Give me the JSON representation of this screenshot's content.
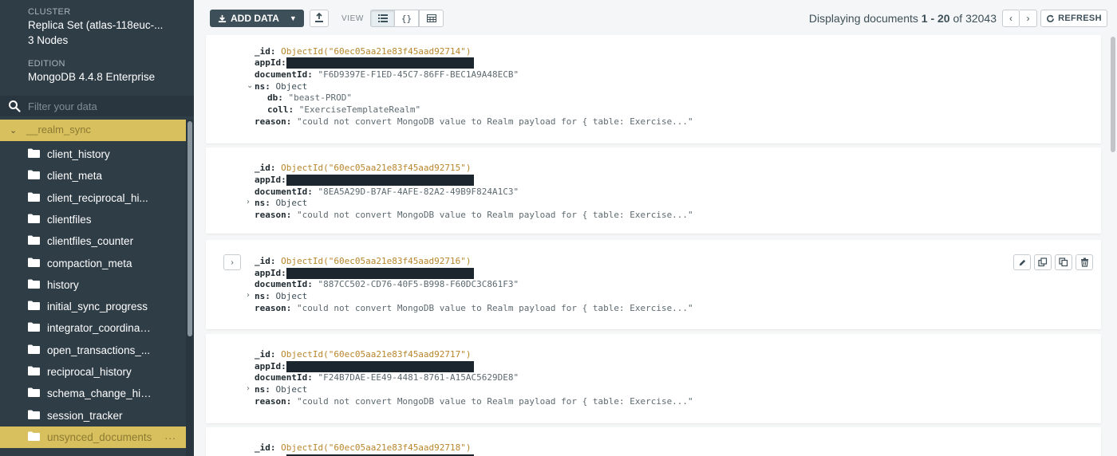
{
  "sidebar": {
    "cluster_caption": "CLUSTER",
    "cluster_name": "Replica Set (atlas-118euc-...",
    "cluster_nodes": "3 Nodes",
    "edition_caption": "EDITION",
    "edition_value": "MongoDB 4.4.8 Enterprise",
    "filter_placeholder": "Filter your data",
    "database": "__realm_sync",
    "collections": [
      "client_history",
      "client_meta",
      "client_reciprocal_hi...",
      "clientfiles",
      "clientfiles_counter",
      "compaction_meta",
      "history",
      "initial_sync_progress",
      "integrator_coordinator",
      "open_transactions_...",
      "reciprocal_history",
      "schema_change_his...",
      "session_tracker",
      "unsynced_documents"
    ],
    "selected_collection": "unsynced_documents",
    "more_label": "..."
  },
  "toolbar": {
    "add_data_label": "ADD DATA",
    "view_label": "VIEW",
    "json_view_label": "{}",
    "pager_prefix": "Displaying documents",
    "pager_range": "1 - 20",
    "pager_of": "of",
    "pager_total": "32043",
    "refresh_label": "REFRESH",
    "prev_label": "‹",
    "next_label": "›"
  },
  "documents": [
    {
      "id_key": "_id:",
      "id_value": "ObjectId(\"60ec05aa21e83f45aad92714\")",
      "appid_key": "appId:",
      "documentid_key": "documentId:",
      "documentid_value": "\"F6D9397E-F1ED-45C7-86FF-BEC1A9A48ECB\"",
      "ns_key": "ns:",
      "ns_value": "Object",
      "ns_expanded": true,
      "db_key": "db:",
      "db_value": "\"beast-PROD\"",
      "coll_key": "coll:",
      "coll_value": "\"ExerciseTemplateRealm\"",
      "reason_key": "reason:",
      "reason_value": "\"could not convert MongoDB value to Realm payload for { table: Exercise...\""
    },
    {
      "id_key": "_id:",
      "id_value": "ObjectId(\"60ec05aa21e83f45aad92715\")",
      "appid_key": "appId:",
      "documentid_key": "documentId:",
      "documentid_value": "\"8EA5A29D-B7AF-4AFE-82A2-49B9F824A1C3\"",
      "ns_key": "ns:",
      "ns_value": "Object",
      "reason_key": "reason:",
      "reason_value": "\"could not convert MongoDB value to Realm payload for { table: Exercise...\""
    },
    {
      "id_key": "_id:",
      "id_value": "ObjectId(\"60ec05aa21e83f45aad92716\")",
      "appid_key": "appId:",
      "documentid_key": "documentId:",
      "documentid_value": "\"887CC502-CD76-40F5-B998-F60DC3C861F3\"",
      "ns_key": "ns:",
      "ns_value": "Object",
      "reason_key": "reason:",
      "reason_value": "\"could not convert MongoDB value to Realm payload for { table: Exercise...\""
    },
    {
      "id_key": "_id:",
      "id_value": "ObjectId(\"60ec05aa21e83f45aad92717\")",
      "appid_key": "appId:",
      "documentid_key": "documentId:",
      "documentid_value": "\"F24B7DAE-EE49-4481-8761-A15AC5629DE8\"",
      "ns_key": "ns:",
      "ns_value": "Object",
      "reason_key": "reason:",
      "reason_value": "\"could not convert MongoDB value to Realm payload for { table: Exercise...\""
    },
    {
      "id_key": "_id:",
      "id_value": "ObjectId(\"60ec05aa21e83f45aad92718\")"
    }
  ]
}
